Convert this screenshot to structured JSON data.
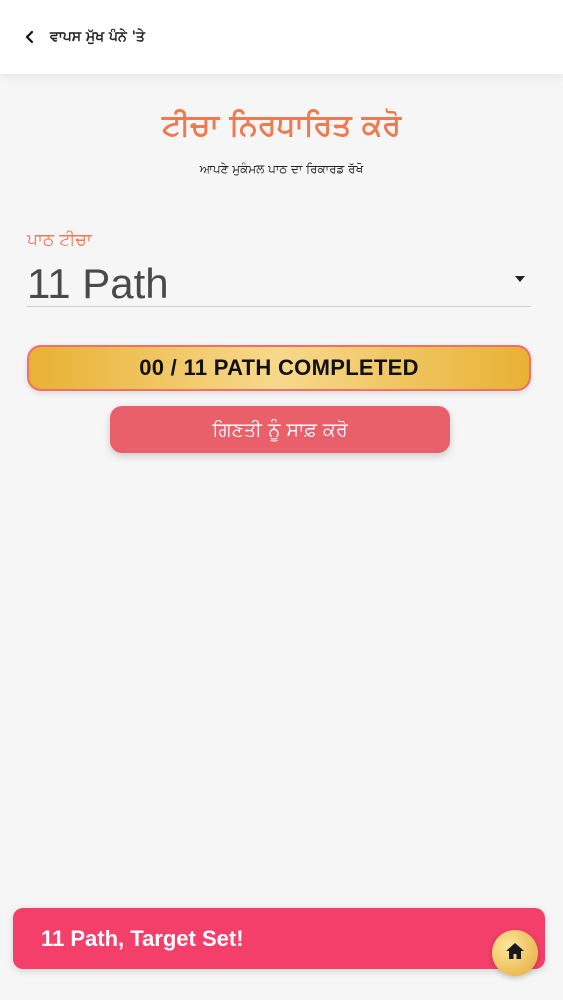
{
  "header": {
    "back_label": "ਵਾਪਸ ਮੁੱਖ ਪੰਨੇ 'ਤੇ",
    "back_icon": "chevron-left-icon"
  },
  "main": {
    "title": "ਟੀਚਾ ਨਿਰਧਾਰਿਤ ਕਰੋ",
    "subtitle": "ਆਪਣੇ ਮੁਕੰਮਲ ਪਾਠ ਦਾ ਰਿਕਾਰਡ ਰੱਖੋ",
    "target_label": "ਪਾਠ ਟੀਚਾ",
    "target_select": {
      "selected": "11 Path",
      "icon": "caret-down-icon"
    },
    "progress_text": "00 / 11 PATH COMPLETED",
    "reset_label": "ਗਿਣਤੀ ਨੂੰ ਸਾਫ਼ ਕਰੋ"
  },
  "toast": {
    "message": "11 Path, Target Set!"
  },
  "home_button": {
    "icon": "home-icon"
  },
  "colors": {
    "accent_orange": "#ef7a52",
    "gold": "#e8b133",
    "reset_red": "#e9606b",
    "toast_pink": "#f43f6a"
  }
}
